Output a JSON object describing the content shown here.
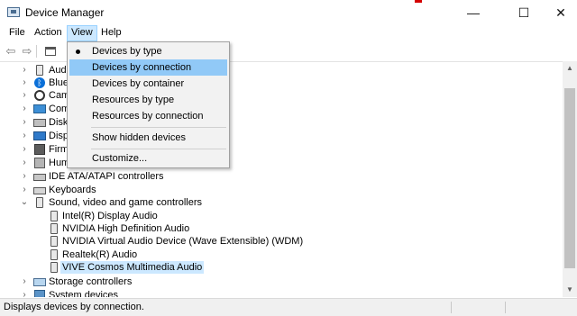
{
  "window": {
    "title": "Device Manager",
    "minimize": "—",
    "maximize": "☐",
    "close": "✕"
  },
  "menubar": {
    "file": "File",
    "action": "Action",
    "view": "View",
    "help": "Help"
  },
  "tree": {
    "items": [
      {
        "label": "Aud",
        "icon": "speaker-icon",
        "expand": "›"
      },
      {
        "label": "Blue",
        "icon": "bluetooth-icon",
        "expand": "›"
      },
      {
        "label": "Cam",
        "icon": "camera-icon",
        "expand": "›"
      },
      {
        "label": "Com",
        "icon": "computer-icon",
        "expand": "›"
      },
      {
        "label": "Disk",
        "icon": "disk-icon",
        "expand": "›"
      },
      {
        "label": "Disp",
        "icon": "display-icon",
        "expand": "›"
      },
      {
        "label": "Firm",
        "icon": "firmware-icon",
        "expand": "›"
      },
      {
        "label": "Hum",
        "icon": "hid-icon",
        "expand": "›"
      },
      {
        "label": "IDE ATA/ATAPI controllers",
        "icon": "ide-icon",
        "expand": "›"
      },
      {
        "label": "Keyboards",
        "icon": "keyboard-icon",
        "expand": "›"
      },
      {
        "label": "Sound, video and game controllers",
        "icon": "speaker-icon",
        "expand": "⌄"
      },
      {
        "label": "Intel(R) Display Audio",
        "icon": "speaker-icon"
      },
      {
        "label": "NVIDIA High Definition Audio",
        "icon": "speaker-icon"
      },
      {
        "label": "NVIDIA Virtual Audio Device (Wave Extensible) (WDM)",
        "icon": "speaker-icon"
      },
      {
        "label": "Realtek(R) Audio",
        "icon": "speaker-icon"
      },
      {
        "label": "VIVE Cosmos Multimedia Audio",
        "icon": "speaker-icon",
        "selected": true
      },
      {
        "label": "Storage controllers",
        "icon": "storage-icon",
        "expand": "›"
      },
      {
        "label": "System devices",
        "icon": "system-icon",
        "expand": "›"
      }
    ]
  },
  "view_menu": {
    "items": [
      {
        "label": "Devices by type",
        "checked": true
      },
      {
        "label": "Devices by connection",
        "highlighted": true
      },
      {
        "label": "Devices by container"
      },
      {
        "label": "Resources by type"
      },
      {
        "label": "Resources by connection"
      },
      {
        "label": "Show hidden devices"
      },
      {
        "label": "Customize..."
      }
    ]
  },
  "status": {
    "text": "Displays devices by connection."
  },
  "colors": {
    "selection": "#cce8ff",
    "menu_hover": "#91c9f7",
    "menu_bg": "#f2f2f2"
  }
}
